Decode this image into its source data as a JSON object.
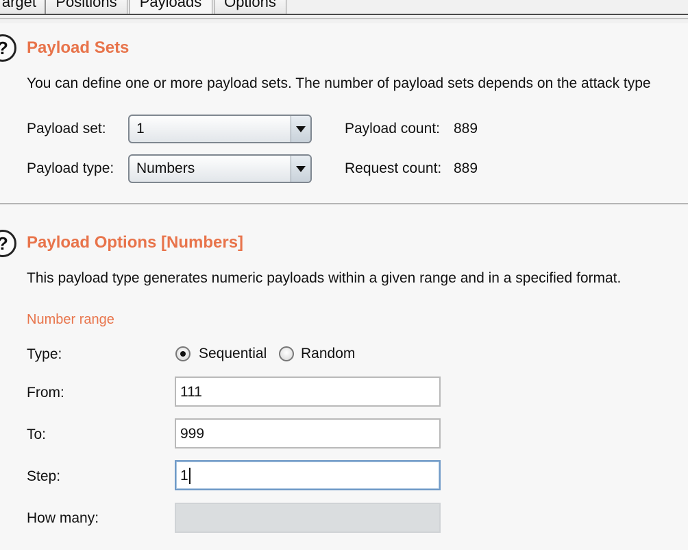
{
  "tabs": [
    {
      "label": "Target",
      "active": false
    },
    {
      "label": "Positions",
      "active": false
    },
    {
      "label": "Payloads",
      "active": true
    },
    {
      "label": "Options",
      "active": false
    }
  ],
  "payload_sets": {
    "help_icon": "?",
    "title": "Payload Sets",
    "description": "You can define one or more payload sets. The number of payload sets depends on the attack type",
    "payload_set_label": "Payload set:",
    "payload_set_value": "1",
    "payload_count_label": "Payload count:",
    "payload_count_value": "889",
    "payload_type_label": "Payload type:",
    "payload_type_value": "Numbers",
    "request_count_label": "Request count:",
    "request_count_value": "889"
  },
  "payload_options": {
    "help_icon": "?",
    "title": "Payload Options [Numbers]",
    "description": "This payload type generates numeric payloads within a given range and in a specified format.",
    "number_range_heading": "Number range",
    "type_label": "Type:",
    "type_options": [
      {
        "label": "Sequential",
        "selected": true
      },
      {
        "label": "Random",
        "selected": false
      }
    ],
    "from_label": "From:",
    "from_value": "111",
    "to_label": "To:",
    "to_value": "999",
    "step_label": "Step:",
    "step_value": "1",
    "how_many_label": "How many:",
    "how_many_value": ""
  },
  "colors": {
    "accent": "#e8744b",
    "focus_border": "#6f9ac7"
  }
}
